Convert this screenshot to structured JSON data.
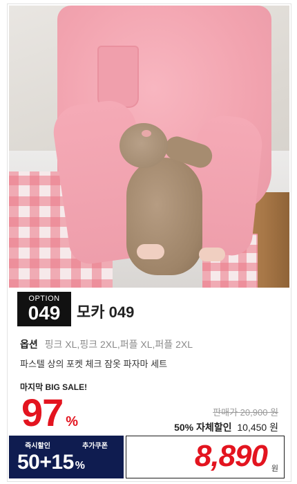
{
  "product": {
    "option_label": "OPTION",
    "option_number": "049",
    "title": "모카 049",
    "options_label": "옵션",
    "options_values": "핑크 XL,핑크 2XL,퍼플 XL,퍼플 2XL",
    "description": "파스텔 상의 포켓 체크 잠옷 파자마 세트"
  },
  "sale": {
    "banner": "마지막 BIG SALE!",
    "discount_value": "97",
    "discount_unit": "%",
    "original_price_text": "판매가 20,900 원",
    "self_discount_label": "50% 자체할인",
    "self_discount_price": "10,450",
    "self_discount_unit": "원"
  },
  "coupon": {
    "instant_label": "즉시할인",
    "extra_label": "추가쿠폰",
    "combo_text": "50+15",
    "combo_unit": "%"
  },
  "final": {
    "price": "8,890",
    "unit": "원"
  },
  "colors": {
    "accent_red": "#e3141f",
    "navy": "#0f1c50",
    "badge_black": "#111111"
  }
}
